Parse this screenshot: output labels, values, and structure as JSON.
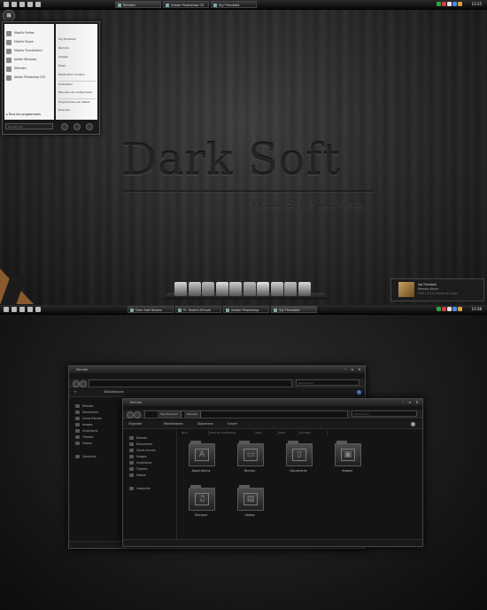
{
  "top_screen": {
    "taskbar": {
      "buttons": [
        {
          "label": "Remote",
          "active": true
        },
        {
          "label": "Adobe Photoshop CS"
        },
        {
          "label": "Sig Theobald"
        }
      ],
      "clock": "13:25"
    },
    "start_menu": {
      "orb_glyph": "⊞",
      "pinned": [
        "Mozilla Firefox",
        "Mozilla Skype",
        "Mozilla Thunderbird",
        "Adobe Windows",
        "Ultimate",
        "Adobe Photoshop CS3"
      ],
      "right_links": [
        "Sig Theobald",
        "Remote",
        "Images",
        "Music",
        "Exploration modern",
        "Ordinateur",
        "Panneau de configuration",
        "Programmes par defaut",
        "Executer"
      ],
      "all_programs": "Tous les programmes",
      "search_placeholder": "Rechercher"
    },
    "brand_title": "Dark Soft",
    "tagline": "Visual Style for Vista",
    "widget": {
      "title": "Sig Theobald",
      "line1": "Remote Album",
      "line2": "0:00 / 3:24 Lecture en cours"
    }
  },
  "bottom_screen": {
    "taskbar": {
      "buttons": [
        {
          "label": "Dark Soft Rebels"
        },
        {
          "label": "Pr. Toolkit d'Ecole"
        },
        {
          "label": "Adobe Photoshop"
        },
        {
          "label": "Sig Theobald",
          "active": true
        }
      ],
      "clock": "13:38"
    },
    "back_window": {
      "title": "Remote",
      "crumb": "Bibliotheques",
      "search_placeholder": "Rechercher",
      "sidebar": [
        "Remote",
        "Documents",
        "Cloud d'ecole",
        "Images",
        "Graphisme",
        "Themes",
        "Videos"
      ],
      "computer": "Computer"
    },
    "front_window": {
      "title": "Remote",
      "crumbs": [
        "Sig Theobald",
        "Remote"
      ],
      "search_placeholder": "Rechercher",
      "command_bar": [
        "Organiser",
        "Bibliotheques",
        "Diaporama",
        "Graver"
      ],
      "sidebar": [
        "Remote",
        "Documents",
        "Cloud d'ecole",
        "Images",
        "Graphisme",
        "Themes",
        "Videos"
      ],
      "computer": "Computer",
      "columns": [
        "Nom",
        "Date de modification",
        "Type",
        "Taille",
        "Duration"
      ],
      "folders": [
        {
          "label": "Applications",
          "glyph": "A"
        },
        {
          "label": "Bureau",
          "glyph": "▭"
        },
        {
          "label": "Documents",
          "glyph": "▯"
        },
        {
          "label": "Images",
          "glyph": "▣"
        },
        {
          "label": "Musique",
          "glyph": "♫"
        },
        {
          "label": "Videos",
          "glyph": "▤"
        }
      ]
    }
  },
  "colors": {
    "dock": [
      "#d8d8d8",
      "#c9c9c9",
      "#bdbdbd",
      "#e0e0e0",
      "#cfcfcf",
      "#bcbcbc",
      "#e6e6e6",
      "#d2d2d2",
      "#c2c2c2",
      "#dadada"
    ],
    "tray": [
      "#2ea04a",
      "#d43b3b",
      "#e0e0e0",
      "#4a8adf",
      "#d2a43a"
    ]
  }
}
